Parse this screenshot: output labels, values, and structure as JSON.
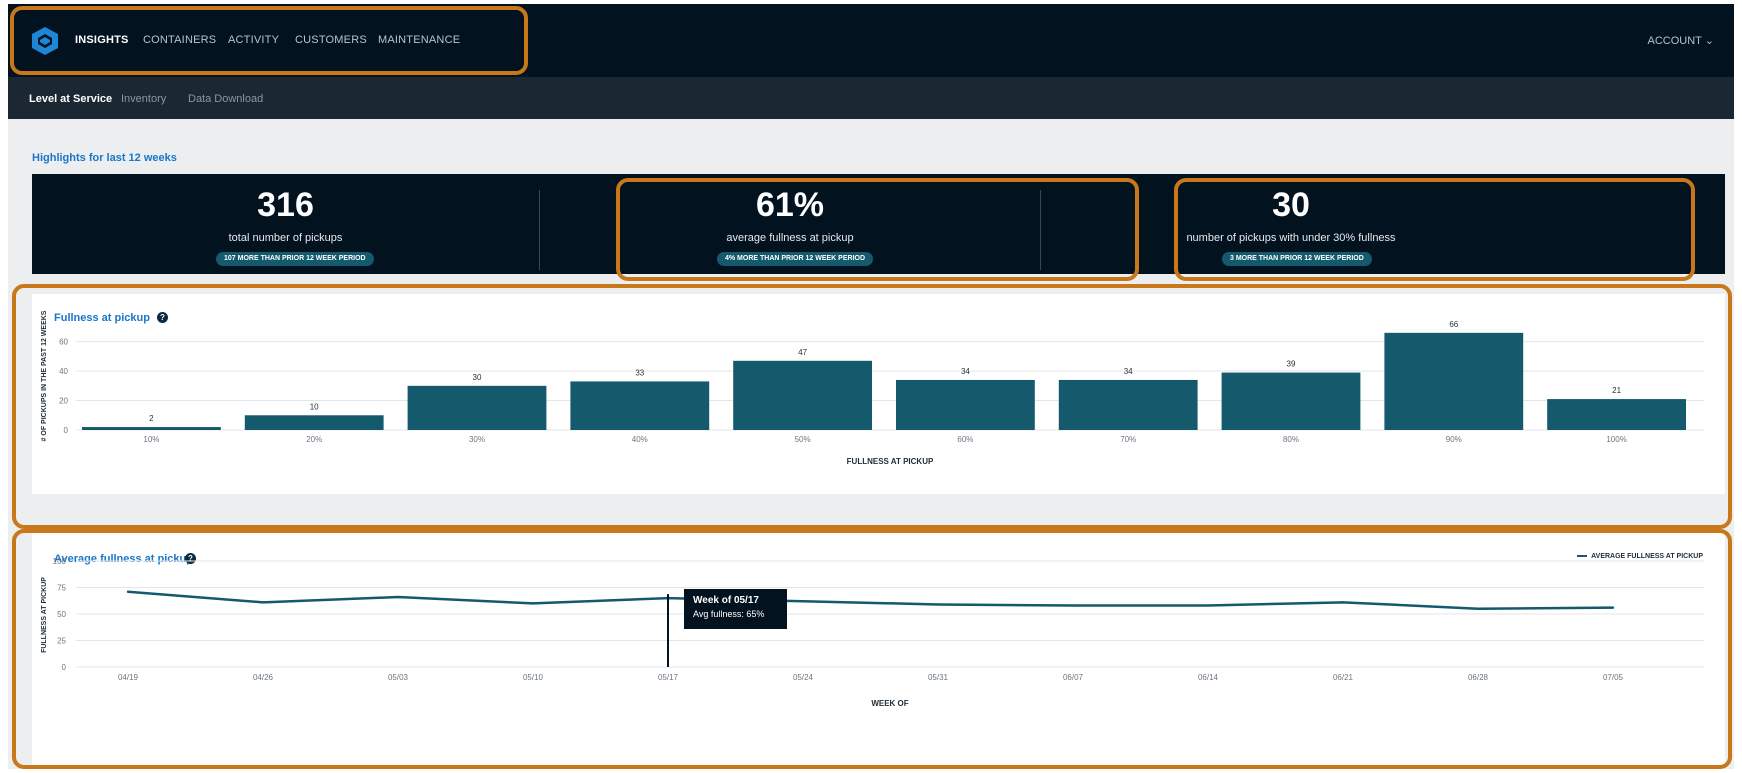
{
  "topnav": {
    "items": [
      {
        "label": "INSIGHTS",
        "active": true
      },
      {
        "label": "CONTAINERS",
        "active": false
      },
      {
        "label": "ACTIVITY",
        "active": false
      },
      {
        "label": "CUSTOMERS",
        "active": false
      },
      {
        "label": "MAINTENANCE",
        "active": false
      }
    ],
    "account_label": "ACCOUNT"
  },
  "subnav": {
    "items": [
      {
        "label": "Level at Service",
        "active": true
      },
      {
        "label": "Inventory",
        "active": false
      },
      {
        "label": "Data Download",
        "active": false
      }
    ]
  },
  "highlights": {
    "title": "Highlights for last 12 weeks",
    "stats": [
      {
        "value": "316",
        "label": "total number of pickups",
        "pill": "107 MORE THAN PRIOR 12 WEEK PERIOD"
      },
      {
        "value": "61%",
        "label": "average fullness at pickup",
        "pill": "4% MORE THAN PRIOR 12 WEEK PERIOD"
      },
      {
        "value": "30",
        "label": "number of pickups with under 30% fullness",
        "pill": "3 MORE THAN PRIOR 12 WEEK PERIOD"
      }
    ]
  },
  "panels": {
    "fullness_title": "Fullness at pickup",
    "avg_title": "Average fullness at pickup",
    "legend_label": "AVERAGE FULLNESS AT PICKUP"
  },
  "tooltip": {
    "line1": "Week of 05/17",
    "line2": "Avg fullness: 65%"
  },
  "colors": {
    "accent": "#1976c8",
    "bar": "#145a6c",
    "nav_bg": "#03121f",
    "highlight": "#c8771a"
  },
  "chart_data": [
    {
      "type": "bar",
      "title": "Fullness at pickup",
      "xlabel": "FULLNESS AT PICKUP",
      "ylabel": "# OF PICKUPS IN THE PAST 12 WEEKS",
      "categories": [
        "10%",
        "20%",
        "30%",
        "40%",
        "50%",
        "60%",
        "70%",
        "80%",
        "90%",
        "100%"
      ],
      "values": [
        2,
        10,
        30,
        33,
        47,
        34,
        34,
        39,
        66,
        21
      ],
      "yticks": [
        "0",
        "20",
        "40",
        "60"
      ],
      "ylim": [
        0,
        72
      ],
      "grid": true
    },
    {
      "type": "line",
      "title": "Average fullness at pickup",
      "xlabel": "WEEK OF",
      "ylabel": "FULLNESS AT PICKUP",
      "x": [
        "04/19",
        "04/26",
        "05/03",
        "05/10",
        "05/17",
        "05/24",
        "05/31",
        "06/07",
        "06/14",
        "06/21",
        "06/28",
        "07/05"
      ],
      "series": [
        {
          "name": "AVERAGE FULLNESS AT PICKUP",
          "values": [
            71,
            61,
            66,
            60,
            65,
            62,
            59,
            58,
            58,
            61,
            55,
            56
          ]
        }
      ],
      "yticks": [
        "0",
        "25",
        "50",
        "75",
        "100"
      ],
      "ylim": [
        0,
        100
      ],
      "grid": true,
      "legend": "top-right"
    }
  ]
}
